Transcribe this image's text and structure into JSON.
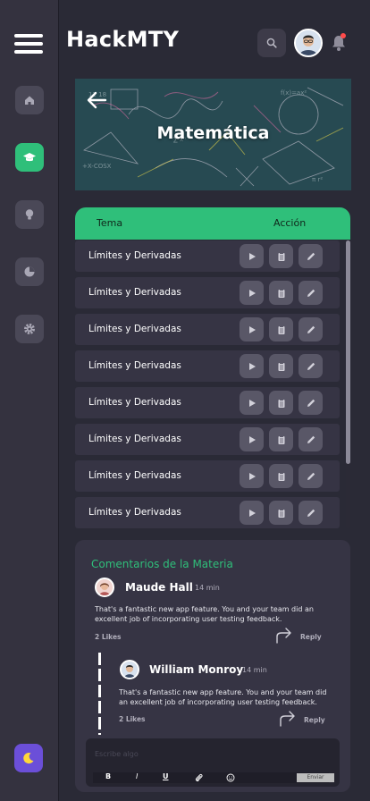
{
  "header": {
    "app_title": "HackMTY"
  },
  "sidebar": {
    "items": [
      "home-icon",
      "graduation-cap-icon",
      "lightbulb-icon",
      "pie-chart-icon",
      "gear-icon"
    ],
    "active": "graduation-cap-icon",
    "accent": "#2fbf7a"
  },
  "banner": {
    "title": "Matemática"
  },
  "table": {
    "col_topic": "Tema",
    "col_action": "Acción",
    "rows": [
      "Límites y Derivadas",
      "Límites y Derivadas",
      "Límites y Derivadas",
      "Límites y Derivadas",
      "Límites y Derivadas",
      "Límites y Derivadas",
      "Límites y Derivadas",
      "Límites y Derivadas"
    ]
  },
  "comments": {
    "title": "Comentarios de la Materia",
    "items": [
      {
        "name": "Maude Hall",
        "time": "14 min",
        "text_line1": "That's a fantastic new app feature. You and your team did an",
        "text_line2": "excellent job of incorporating user testing feedback.",
        "likes": "2 Likes",
        "reply": "Reply"
      },
      {
        "name": "William Monroy",
        "time": "14 min",
        "text_line1": "That's a fantastic new app feature. You and your team did",
        "text_line2": "an excellent job of incorporating user testing feedback.",
        "likes": "2 Likes",
        "reply": "Reply"
      }
    ],
    "editor_placeholder": "Escribe algo",
    "toolbar": {
      "bold": "B",
      "italic": "I",
      "underline": "U",
      "send": "Enviar"
    }
  }
}
